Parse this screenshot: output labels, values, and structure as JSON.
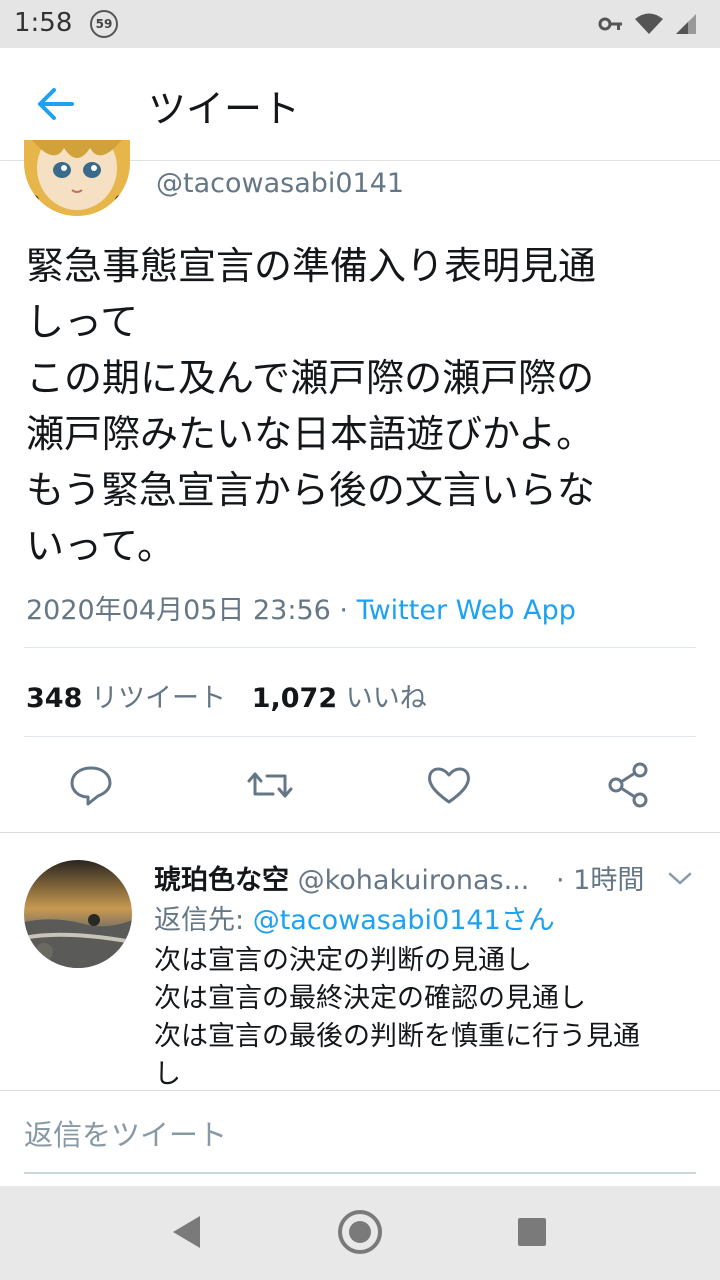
{
  "status_bar": {
    "time": "1:58",
    "notification_count": "59"
  },
  "app_bar": {
    "title": "ツイート",
    "back_icon": "arrow-left-icon"
  },
  "tweet": {
    "handle": "@tacowasabi0141",
    "text": "緊急事態宣言の準備入り表明見通\nしって\nこの期に及んで瀬戸際の瀬戸際の\n瀬戸際みたいな日本語遊びかよ。\nもう緊急宣言から後の文言いらな\nいって。",
    "timestamp": "2020年04月05日 23:56",
    "separator": " · ",
    "source": "Twitter Web App",
    "retweets_count": "348",
    "retweets_label": "リツイート",
    "likes_count": "1,072",
    "likes_label": "いいね",
    "actions": [
      "reply-icon",
      "retweet-icon",
      "like-icon",
      "share-icon"
    ]
  },
  "reply": {
    "name": "琥珀色な空",
    "handle": "@kohakuironas...",
    "time": "· 1時間",
    "reply_to_label": "返信先: ",
    "reply_to_mention": "@tacowasabi0141さん",
    "text": "次は宣言の決定の判断の見通し\n次は宣言の最終決定の確認の見通し\n次は宣言の最後の判断を慎重に行う見通\nし"
  },
  "compose": {
    "placeholder": "返信をツイート"
  },
  "colors": {
    "accent": "#1da1f2",
    "secondary_text": "#657786",
    "text": "#14171a"
  }
}
